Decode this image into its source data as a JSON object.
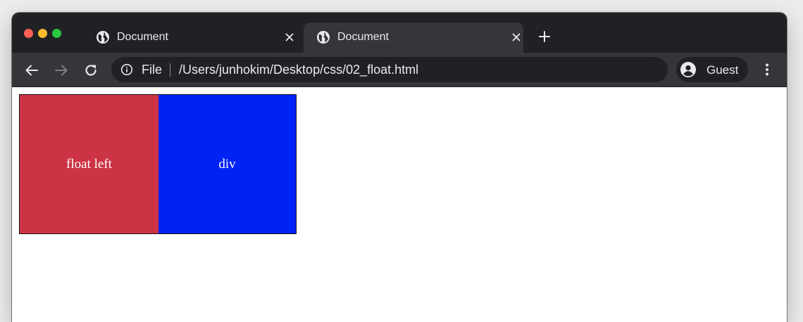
{
  "browser": {
    "tabs": [
      {
        "title": "Document",
        "active": false,
        "icon": "globe-icon"
      },
      {
        "title": "Document",
        "active": true,
        "icon": "globe-icon"
      }
    ],
    "toolbar": {
      "scheme_label": "File",
      "url": "/Users/junhokim/Desktop/css/02_float.html",
      "profile_label": "Guest"
    }
  },
  "page": {
    "boxes": [
      {
        "label": "float left",
        "color": "#cc3344"
      },
      {
        "label": "div",
        "color": "#0022f5"
      }
    ]
  },
  "colors": {
    "tabstrip": "#202124",
    "toolbar": "#35363a",
    "omnibox": "#202124"
  }
}
